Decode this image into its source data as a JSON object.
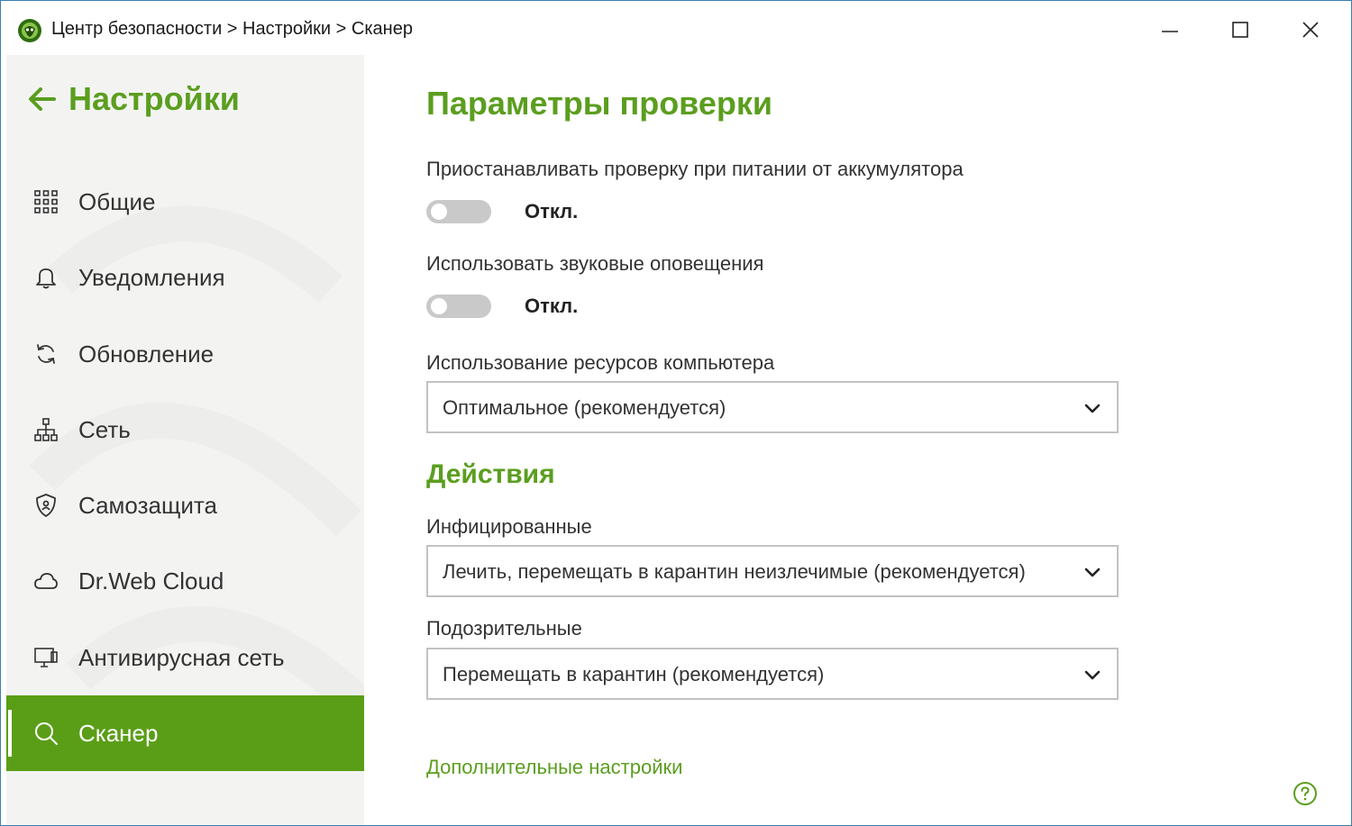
{
  "window": {
    "breadcrumb": "Центр безопасности > Настройки > Сканер",
    "controls": {
      "minimize": "minimize-icon",
      "maximize": "maximize-icon",
      "close": "close-icon"
    }
  },
  "sidebar": {
    "back_label": "Настройки",
    "items": [
      {
        "label": "Общие",
        "icon": "grid-icon",
        "active": false
      },
      {
        "label": "Уведомления",
        "icon": "bell-icon",
        "active": false
      },
      {
        "label": "Обновление",
        "icon": "refresh-icon",
        "active": false
      },
      {
        "label": "Сеть",
        "icon": "network-icon",
        "active": false
      },
      {
        "label": "Самозащита",
        "icon": "shield-icon",
        "active": false
      },
      {
        "label": "Dr.Web Cloud",
        "icon": "cloud-icon",
        "active": false
      },
      {
        "label": "Антивирусная сеть",
        "icon": "monitor-icon",
        "active": false
      },
      {
        "label": "Сканер",
        "icon": "search-icon",
        "active": true
      }
    ]
  },
  "main": {
    "title": "Параметры проверки",
    "battery": {
      "label": "Приостанавливать проверку при питании от аккумулятора",
      "state": "Откл."
    },
    "sound": {
      "label": "Использовать звуковые оповещения",
      "state": "Откл."
    },
    "resources": {
      "label": "Использование ресурсов компьютера",
      "value": "Оптимальное (рекомендуется)"
    },
    "actions_title": "Действия",
    "infected": {
      "label": "Инфицированные",
      "value": "Лечить, перемещать в карантин неизлечимые (рекомендуется)"
    },
    "suspicious": {
      "label": "Подозрительные",
      "value": "Перемещать в карантин (рекомендуется)"
    },
    "advanced_link": "Дополнительные настройки"
  },
  "colors": {
    "accent": "#5b9e1f",
    "active_nav": "#5a9e17",
    "sidebar_bg": "#f3f4f2",
    "toggle_off": "#c9c9c9"
  }
}
